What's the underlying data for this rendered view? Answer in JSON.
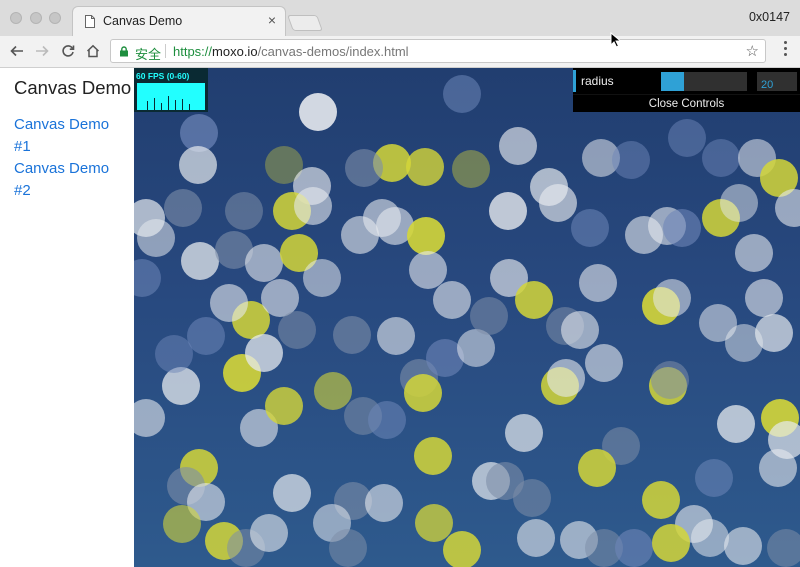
{
  "browser": {
    "tab_title": "Canvas Demo",
    "tab_close": "×",
    "profile_label": "0x0147",
    "secure_label": "安全",
    "url_scheme": "https://",
    "url_host": "moxo.io",
    "url_path": "/canvas-demos/index.html",
    "star": "☆",
    "back": "←",
    "forward": "→",
    "reload": "↻"
  },
  "sidebar": {
    "title": "Canvas Demo",
    "links": [
      {
        "label": "Canvas Demo #1"
      },
      {
        "label": "Canvas Demo #2"
      }
    ]
  },
  "fps_meter": {
    "text": "60 FPS (0-60)"
  },
  "controls": {
    "param_label": "radius",
    "param_value": "20",
    "slider_fraction": 0.27,
    "close_label": "Close Controls"
  },
  "colors": {
    "accent": "#2fa1d6",
    "link": "#1a73d9",
    "canvas_top": "#213e70",
    "canvas_bottom": "#2e5a8d",
    "particle_yellow": "#d4d638",
    "particle_white": "#e6e9ee",
    "particle_blue": "#6e86b8",
    "particle_olive": "#8f9950",
    "particle_slate": "#7d8ea8",
    "fps_fg": "#22ffff"
  }
}
